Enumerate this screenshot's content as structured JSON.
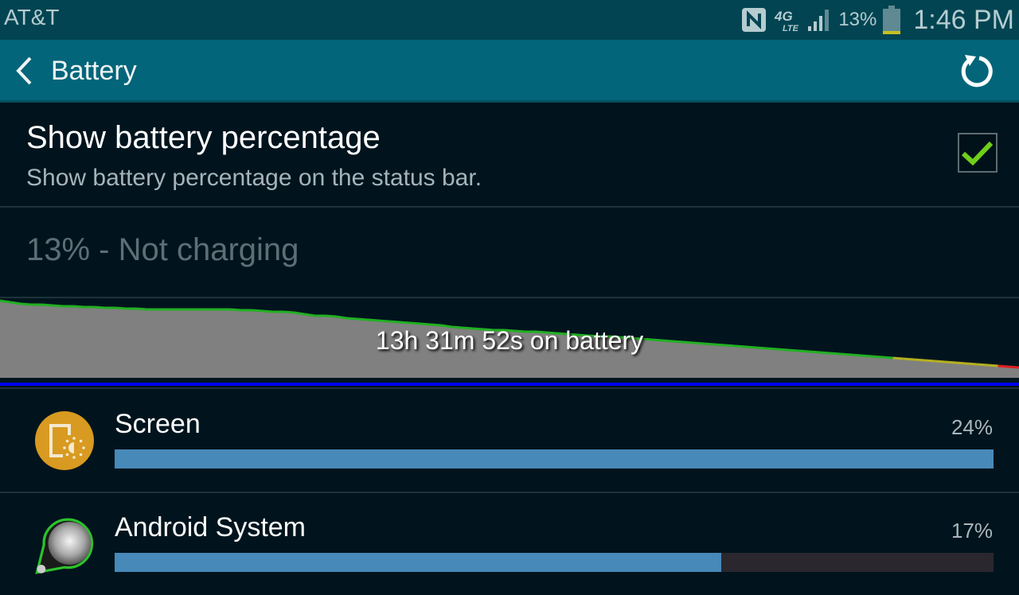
{
  "statusbar": {
    "carrier": "AT&T",
    "icons": [
      "nfc-icon",
      "4g-lte-icon",
      "signal-icon",
      "battery-icon"
    ],
    "network": "4G LTE",
    "battery_percent": "13%",
    "time": "1:46 PM"
  },
  "actionbar": {
    "title": "Battery",
    "back_icon": "chevron-left-icon",
    "refresh_icon": "refresh-icon"
  },
  "preference": {
    "title": "Show battery percentage",
    "summary": "Show battery percentage on the status bar.",
    "checked": true
  },
  "battery_status": "13% - Not charging",
  "graph": {
    "label": "13h 31m 52s on battery",
    "colors": {
      "good": "#22b022",
      "medium": "#b5b020",
      "low": "#e02020",
      "fill": "#808080",
      "baseline": "#0000ee"
    },
    "level_percent_samples": [
      97,
      95,
      93,
      92,
      92,
      91,
      90,
      90,
      89,
      89,
      88,
      88,
      87,
      87,
      86,
      86,
      86,
      86,
      86,
      86,
      86,
      86,
      86,
      85,
      85,
      84,
      83,
      83,
      82,
      80,
      78,
      78,
      77,
      75,
      74,
      73,
      72,
      71,
      70,
      69,
      68,
      67,
      66,
      64,
      63,
      62,
      61,
      60,
      60,
      59,
      58,
      58,
      57,
      56,
      55,
      54,
      53,
      52,
      52,
      51,
      50,
      49,
      48,
      47,
      46,
      45,
      44,
      43,
      42,
      41,
      40,
      39,
      38,
      37,
      36,
      35,
      34,
      33,
      32,
      31,
      30,
      29,
      28,
      27,
      26,
      25,
      24,
      23,
      22,
      21,
      20,
      19,
      18,
      17,
      16,
      15,
      14,
      13
    ]
  },
  "usage": [
    {
      "name": "Screen",
      "percent_label": "24%",
      "bar_fraction": 1.0,
      "icon": "screen-brightness-icon"
    },
    {
      "name": "Android System",
      "percent_label": "17%",
      "bar_fraction": 0.69,
      "icon": "android-system-icon"
    }
  ],
  "colors": {
    "accent_bar": "#4789b8",
    "checkmark": "#6fcf1a",
    "actionbar": "#03657a",
    "statusbar": "#024452"
  }
}
